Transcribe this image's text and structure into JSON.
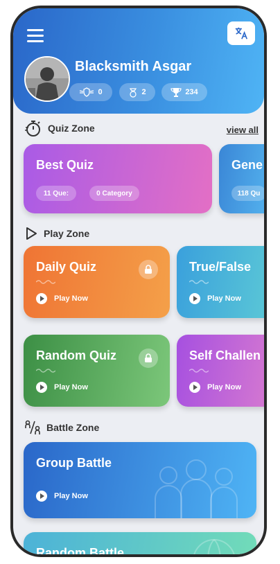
{
  "header": {
    "username": "Blacksmith Asgar",
    "stats": [
      {
        "icon": "badge-icon",
        "value": "0"
      },
      {
        "icon": "coins-icon",
        "value": "2"
      },
      {
        "icon": "trophy-icon",
        "value": "234"
      }
    ]
  },
  "quiz_zone": {
    "title": "Quiz Zone",
    "view_all": "view all",
    "cards": [
      {
        "title": "Best Quiz",
        "questions": "11  Que:",
        "category": "0  Category"
      },
      {
        "title": "Gene",
        "questions": "118  Qu"
      }
    ]
  },
  "play_zone": {
    "title": "Play Zone",
    "cards": [
      {
        "title": "Daily Quiz",
        "action": "Play Now",
        "locked": true
      },
      {
        "title": "True/False",
        "action": "Play Now",
        "locked": false
      },
      {
        "title": "Random Quiz",
        "action": "Play Now",
        "locked": true
      },
      {
        "title": "Self Challen",
        "action": "Play Now",
        "locked": false
      }
    ]
  },
  "battle_zone": {
    "title": "Battle Zone",
    "cards": [
      {
        "title": "Group Battle",
        "action": "Play Now"
      },
      {
        "title": "Random Battle"
      }
    ]
  },
  "colors": {
    "header_start": "#2a67c9",
    "header_end": "#4fb4f5",
    "daily_quiz": "#ef7a3b",
    "random_quiz": "#4f9a52",
    "self_challenge": "#9d5fd8",
    "best_quiz": "#b35ce0"
  }
}
